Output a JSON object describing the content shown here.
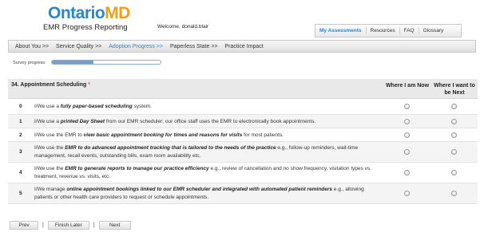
{
  "header": {
    "logo_part1": "Ontario",
    "logo_part2": "MD",
    "subtitle": "EMR Progress Reporting",
    "welcome": "Welcome, donald.blair"
  },
  "top_nav": {
    "items": [
      {
        "label": "My Assessments",
        "active": true
      },
      {
        "label": "Resources",
        "active": false
      },
      {
        "label": "FAQ",
        "active": false
      },
      {
        "label": "Glossary",
        "active": false
      }
    ]
  },
  "section_nav": {
    "items": [
      {
        "label": "About You  >>",
        "active": false
      },
      {
        "label": "Service Quality  >>",
        "active": false
      },
      {
        "label": "Adoption Progress  >>",
        "active": true
      },
      {
        "label": "Paperless State  >>",
        "active": false
      },
      {
        "label": "Practice Impact",
        "active": false
      }
    ]
  },
  "survey_progress": {
    "label": "Survey progress:",
    "fraction": 0.38
  },
  "question": {
    "title": "34. Appointment Scheduling",
    "required_marker": "*",
    "col_now": "Where I am Now",
    "col_next": "Where I want to be Next",
    "rows": [
      {
        "num": "0",
        "pre": "I/We use a ",
        "bold": "fully paper-based scheduling",
        "post": " system.",
        "selected_now": false,
        "selected_next": false
      },
      {
        "num": "1",
        "pre": "I/We use a ",
        "bold": "printed Day Sheet",
        "post": " from our EMR scheduler; our office staff uses the EMR to electronically book appointments.",
        "selected_now": false,
        "selected_next": false
      },
      {
        "num": "2",
        "pre": "I/We use the EMR to ",
        "bold": "view basic appointment booking for times and reasons for visits",
        "post": " for most patients.",
        "selected_now": false,
        "selected_next": false
      },
      {
        "num": "3",
        "pre": "I/We use the ",
        "bold": "EMR to do advanced appointment tracking that is tailored to the needs of the practice",
        "post": " e.g., follow-up reminders, wait-time management, recall events, outstanding bills, exam room availability etc.",
        "selected_now": false,
        "selected_next": false
      },
      {
        "num": "4",
        "pre": "I/We use the ",
        "bold": "EMR to generate reports to manage our practice efficiency",
        "post": " e.g., review of cancellation and no show frequency, visitation types vs. treatment, revenue vs. visits, etc.",
        "selected_now": false,
        "selected_next": false
      },
      {
        "num": "5",
        "pre": "I/We manage ",
        "bold": "online appointment bookings linked to our EMR scheduler and integrated with automated patient reminders",
        "post": " e.g., allowing patients or other health care providers to request or schedule appointments.",
        "selected_now": false,
        "selected_next": false
      }
    ]
  },
  "buttons": {
    "prev": "Prev",
    "finish_later": "Finish Later",
    "next": "Next",
    "separator": "|"
  },
  "colors": {
    "brand_blue": "#2a86c9",
    "brand_orange": "#f39c20",
    "progress_fill": "#7a9fc6"
  }
}
